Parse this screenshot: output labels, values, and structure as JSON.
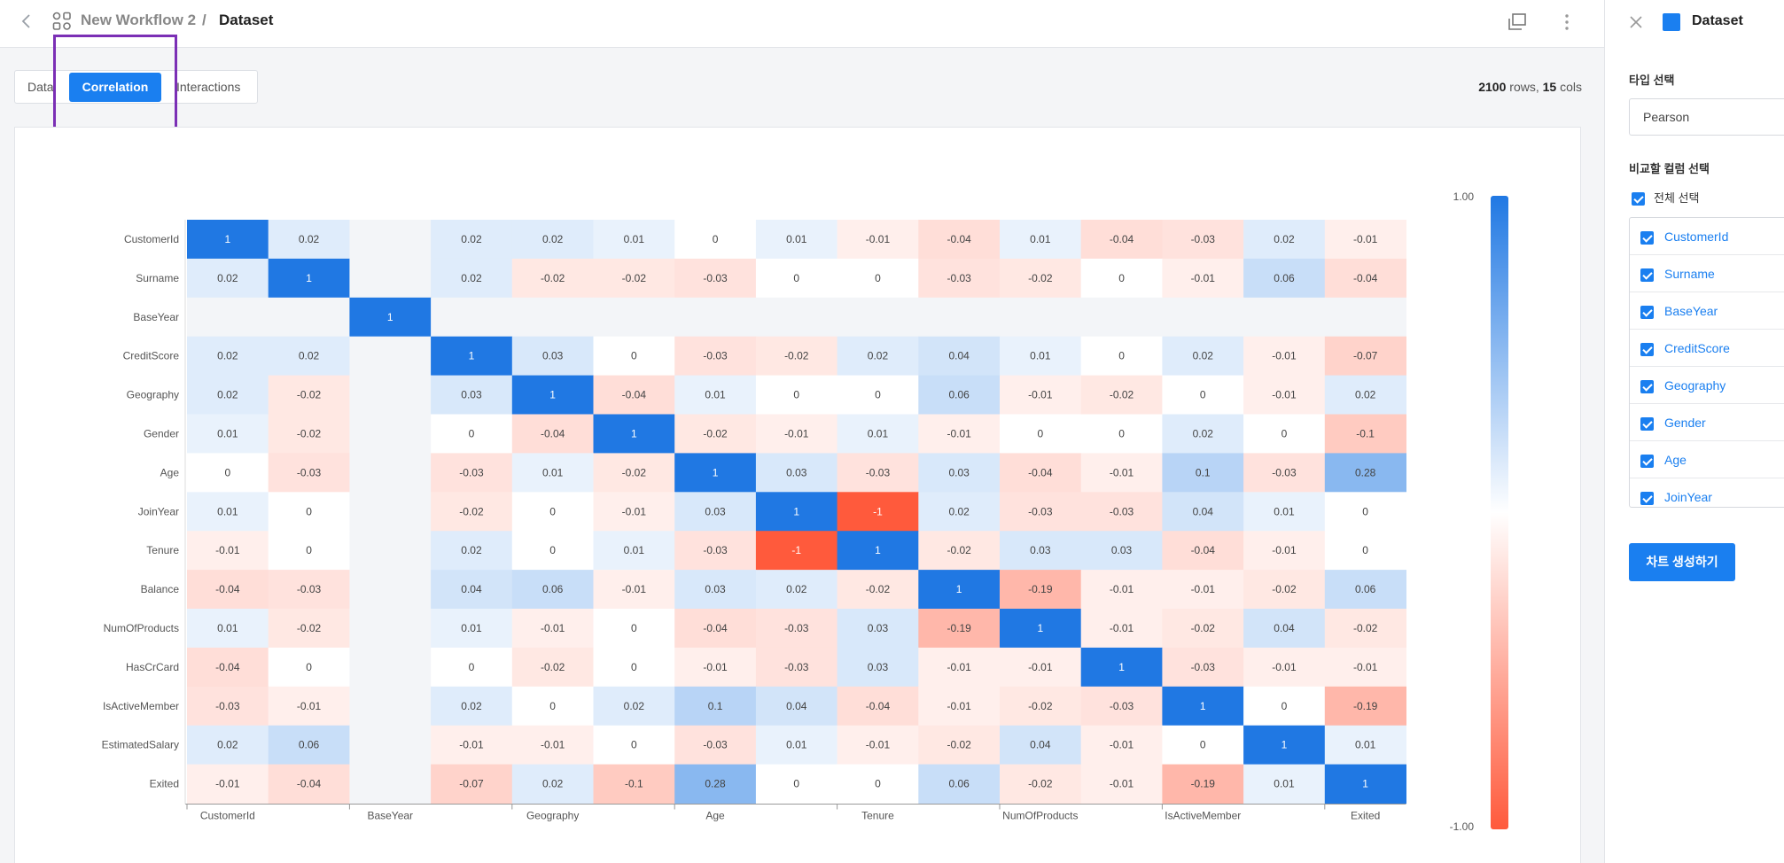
{
  "topbar": {
    "workflow_name": "New Workflow 2",
    "separator": "/",
    "current_page": "Dataset",
    "icons": {
      "back": "chevron-left-icon",
      "workflow": "workflow-grid-icon",
      "copy": "copy-window-icon",
      "more": "more-vertical-icon"
    }
  },
  "tabs": [
    {
      "label": "Data"
    },
    {
      "label": "Correlation",
      "active": true
    },
    {
      "label": "Interactions"
    }
  ],
  "dataset_info": {
    "rows": "2100",
    "rows_label": " rows, ",
    "cols": "15",
    "cols_label": " cols"
  },
  "panel": {
    "title": "Dataset",
    "type_label": "타입 선택",
    "type_value": "Pearson",
    "columns_label": "비교할 컬럼 선택",
    "select_all_label": "전체 선택",
    "column_options": [
      "CustomerId",
      "Surname",
      "BaseYear",
      "CreditScore",
      "Geography",
      "Gender",
      "Age",
      "JoinYear"
    ],
    "create_button": "차트 생성하기",
    "accent_color": "#1a7ff0"
  },
  "chart_data": {
    "type": "heatmap",
    "labels": [
      "CustomerId",
      "Surname",
      "BaseYear",
      "CreditScore",
      "Geography",
      "Gender",
      "Age",
      "JoinYear",
      "Tenure",
      "Balance",
      "NumOfProducts",
      "HasCrCard",
      "IsActiveMember",
      "EstimatedSalary",
      "Exited"
    ],
    "x_tick_labels": [
      "CustomerId",
      "",
      "BaseYear",
      "",
      "Geography",
      "",
      "Age",
      "",
      "Tenure",
      "",
      "NumOfProducts",
      "",
      "IsActiveMember",
      "",
      "Exited"
    ],
    "values": [
      [
        1,
        0.02,
        null,
        0.02,
        0.02,
        0.01,
        0,
        0.01,
        -0.01,
        -0.04,
        0.01,
        -0.04,
        -0.03,
        0.02,
        -0.01
      ],
      [
        0.02,
        1,
        null,
        0.02,
        -0.02,
        -0.02,
        -0.03,
        0,
        0,
        -0.03,
        -0.02,
        0,
        -0.01,
        0.06,
        -0.04
      ],
      [
        null,
        null,
        1,
        null,
        null,
        null,
        null,
        null,
        null,
        null,
        null,
        null,
        null,
        null,
        null
      ],
      [
        0.02,
        0.02,
        null,
        1,
        0.03,
        0,
        -0.03,
        -0.02,
        0.02,
        0.04,
        0.01,
        0,
        0.02,
        -0.01,
        -0.07
      ],
      [
        0.02,
        -0.02,
        null,
        0.03,
        1,
        -0.04,
        0.01,
        0,
        0,
        0.06,
        -0.01,
        -0.02,
        0,
        -0.01,
        0.02
      ],
      [
        0.01,
        -0.02,
        null,
        0,
        -0.04,
        1,
        -0.02,
        -0.01,
        0.01,
        -0.01,
        0,
        0,
        0.02,
        0,
        -0.1
      ],
      [
        0,
        -0.03,
        null,
        -0.03,
        0.01,
        -0.02,
        1,
        0.03,
        -0.03,
        0.03,
        -0.04,
        -0.01,
        0.1,
        -0.03,
        0.28
      ],
      [
        0.01,
        0,
        null,
        -0.02,
        0,
        -0.01,
        0.03,
        1,
        -1,
        0.02,
        -0.03,
        -0.03,
        0.04,
        0.01,
        0
      ],
      [
        -0.01,
        0,
        null,
        0.02,
        0,
        0.01,
        -0.03,
        -1,
        1,
        -0.02,
        0.03,
        0.03,
        -0.04,
        -0.01,
        0
      ],
      [
        -0.04,
        -0.03,
        null,
        0.04,
        0.06,
        -0.01,
        0.03,
        0.02,
        -0.02,
        1,
        -0.19,
        -0.01,
        -0.01,
        -0.02,
        0.06
      ],
      [
        0.01,
        -0.02,
        null,
        0.01,
        -0.01,
        0,
        -0.04,
        -0.03,
        0.03,
        -0.19,
        1,
        -0.01,
        -0.02,
        0.04,
        -0.02
      ],
      [
        -0.04,
        0,
        null,
        0,
        -0.02,
        0,
        -0.01,
        -0.03,
        0.03,
        -0.01,
        -0.01,
        1,
        -0.03,
        -0.01,
        -0.01
      ],
      [
        -0.03,
        -0.01,
        null,
        0.02,
        0,
        0.02,
        0.1,
        0.04,
        -0.04,
        -0.01,
        -0.02,
        -0.03,
        1,
        0,
        -0.19
      ],
      [
        0.02,
        0.06,
        null,
        -0.01,
        -0.01,
        0,
        -0.03,
        0.01,
        -0.01,
        -0.02,
        0.04,
        -0.01,
        0,
        1,
        0.01
      ],
      [
        -0.01,
        -0.04,
        null,
        -0.07,
        0.02,
        -0.1,
        0.28,
        0,
        0,
        0.06,
        -0.02,
        -0.01,
        -0.19,
        0.01,
        1
      ]
    ],
    "color_scale": {
      "min": -1,
      "max": 1,
      "min_label": "-1.00",
      "max_label": "1.00",
      "positive_color": "#2078e3",
      "negative_color": "#ff5a3c",
      "neutral_color": "#ffffff"
    }
  }
}
